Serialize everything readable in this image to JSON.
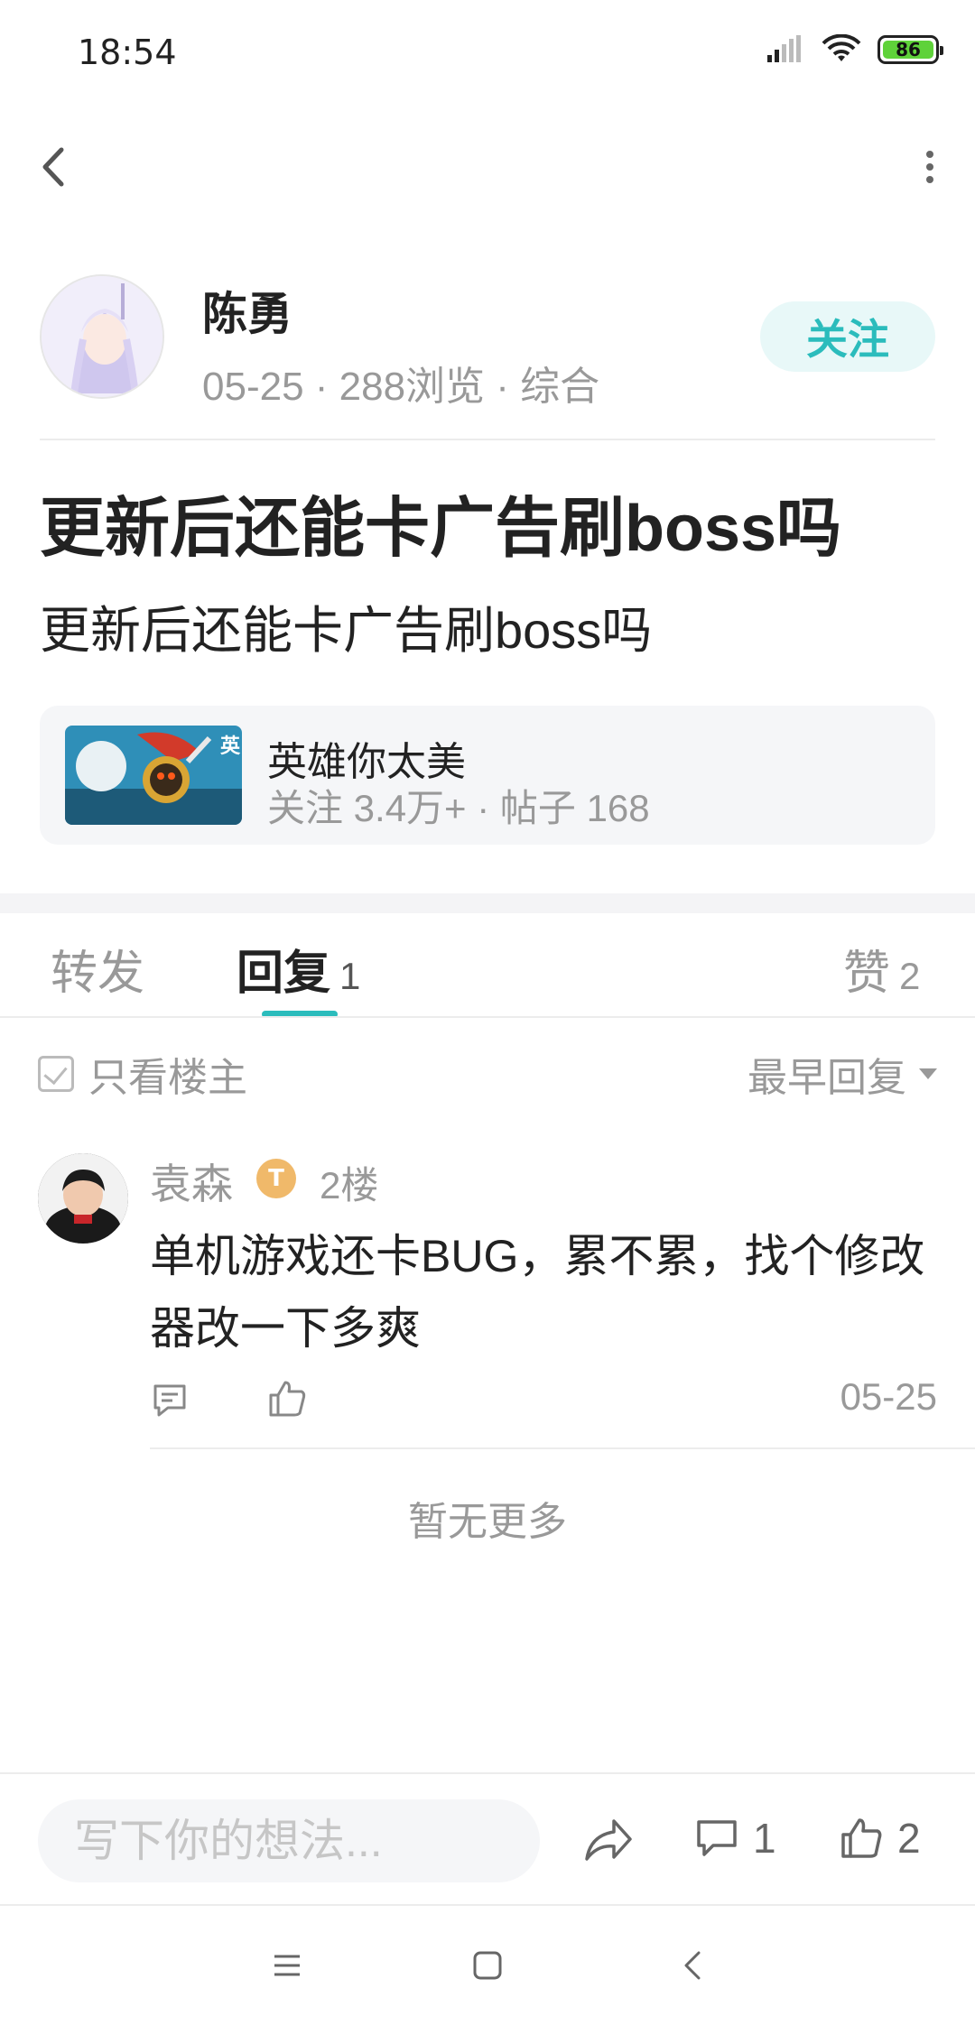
{
  "status_bar": {
    "time": "18:54",
    "battery": "86",
    "icons": [
      "signal-icon",
      "wifi-icon",
      "battery-icon"
    ]
  },
  "header": {
    "back_icon": "chevron-left-icon",
    "more_icon": "vertical-dots-icon"
  },
  "author": {
    "name": "陈勇",
    "meta": "05-25 · 288浏览 · 综合",
    "follow_label": "关注"
  },
  "post": {
    "title": "更新后还能卡广告刷boss吗",
    "body": "更新后还能卡广告刷boss吗"
  },
  "game_card": {
    "name": "英雄你太美",
    "stats": "关注 3.4万+ · 帖子 168"
  },
  "tabs": [
    {
      "label": "转发",
      "count": ""
    },
    {
      "label": "回复",
      "count": "1"
    },
    {
      "label": "赞",
      "count": "2"
    }
  ],
  "filter": {
    "op_only_label": "只看楼主",
    "sort_label": "最早回复"
  },
  "reply": {
    "name": "袁森",
    "badge": "T",
    "floor": "2楼",
    "text": "单机游戏还卡BUG，累不累，找个修改器改一下多爽",
    "date": "05-25"
  },
  "no_more": "暂无更多",
  "bottom_bar": {
    "input_placeholder": "写下你的想法...",
    "comment_count": "1",
    "like_count": "2"
  },
  "colors": {
    "accent": "#2bbcbc",
    "accent_bg": "#e8f8f8",
    "muted_text": "#999999"
  }
}
